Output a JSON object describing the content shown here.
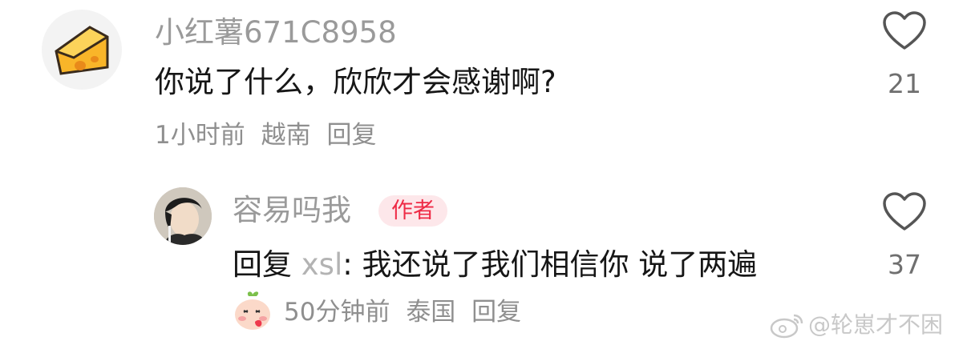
{
  "comments": [
    {
      "username": "小红薯671C8958",
      "avatar": "cheese-avatar",
      "text": "你说了什么，欣欣才会感谢啊?",
      "time": "1小时前",
      "location": "越南",
      "reply_label": "回复",
      "likes": "21"
    }
  ],
  "reply": {
    "username": "容易吗我",
    "author_badge": "作者",
    "prefix": "回复",
    "target": "xsl",
    "separator": ":",
    "text": "我还说了我们相信你 说了两遍",
    "time": "50分钟前",
    "location": "泰国",
    "reply_label": "回复",
    "likes": "37"
  },
  "watermark": "@轮崽才不困",
  "colors": {
    "author_badge_bg": "#fde7ea",
    "author_badge_text": "#ee2a45",
    "cheese": "#f9b529"
  }
}
